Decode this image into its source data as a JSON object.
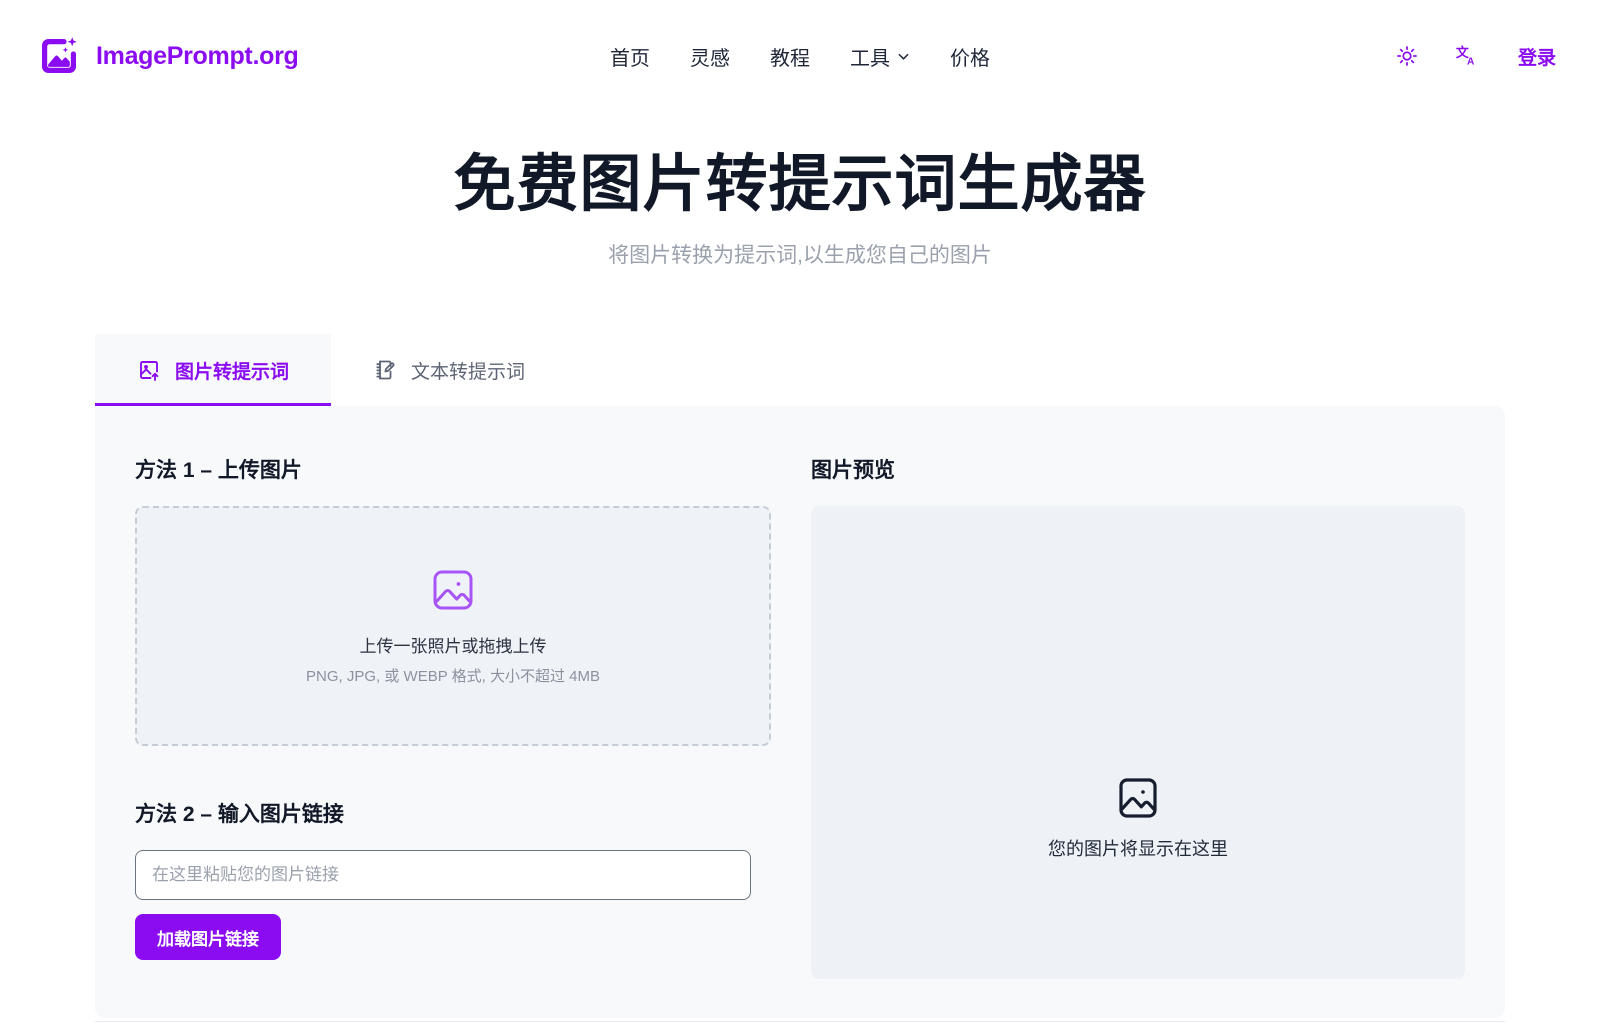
{
  "brand": {
    "name": "ImagePrompt.org",
    "logo_icon": "image-sparkle-icon",
    "color": "#8b0cf0"
  },
  "nav": {
    "items": [
      {
        "label": "首页",
        "icon": null
      },
      {
        "label": "灵感",
        "icon": null
      },
      {
        "label": "教程",
        "icon": null
      },
      {
        "label": "工具",
        "icon": "chevron-down-icon"
      },
      {
        "label": "价格",
        "icon": null
      }
    ]
  },
  "header_right": {
    "theme_toggle_icon": "sun-icon",
    "language_icon": "language-icon",
    "language_glyph": "文A",
    "login_label": "登录"
  },
  "hero": {
    "title": "免费图片转提示词生成器",
    "subtitle": "将图片转换为提示词,以生成您自己的图片"
  },
  "tabs": [
    {
      "label": "图片转提示词",
      "icon": "image-upload-icon",
      "active": true
    },
    {
      "label": "文本转提示词",
      "icon": "notebook-pencil-icon",
      "active": false
    }
  ],
  "main": {
    "method_1": {
      "title": "方法 1 – 上传图片",
      "dropzone_icon": "image-icon",
      "dropzone_main": "上传一张照片或拖拽上传",
      "dropzone_sub": "PNG, JPG, 或 WEBP 格式, 大小不超过 4MB"
    },
    "method_2": {
      "title": "方法 2 – 输入图片链接",
      "input_value": "",
      "input_placeholder": "在这里粘贴您的图片链接",
      "button_label": "加载图片链接"
    },
    "preview": {
      "title": "图片预览",
      "placeholder_icon": "image-icon",
      "placeholder_text": "您的图片将显示在这里"
    }
  },
  "colors": {
    "accent": "#8b0cf0",
    "accent_light": "#a855f7",
    "text_dark": "#111827",
    "text_muted": "#9aa1ad",
    "card_bg": "#f7f9fb",
    "panel_bg": "#eef1f6"
  }
}
